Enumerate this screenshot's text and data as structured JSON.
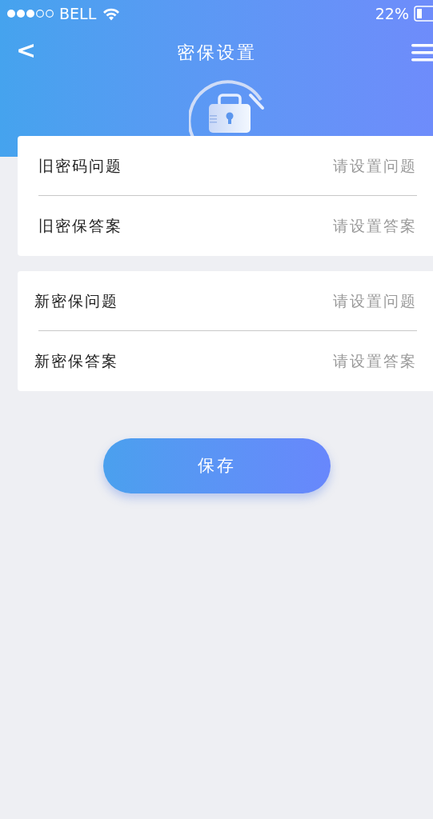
{
  "status_bar": {
    "carrier": "BELL",
    "battery": "22%"
  },
  "header": {
    "back": "<",
    "title": "密保设置"
  },
  "groups": [
    {
      "rows": [
        {
          "label": "旧密码问题",
          "placeholder": "请设置问题"
        },
        {
          "label": "旧密保答案",
          "placeholder": "请设置答案"
        }
      ]
    },
    {
      "rows": [
        {
          "label": "新密保问题",
          "placeholder": "请设置问题"
        },
        {
          "label": "新密保答案",
          "placeholder": "请设置答案"
        }
      ]
    }
  ],
  "save_button": "保存"
}
